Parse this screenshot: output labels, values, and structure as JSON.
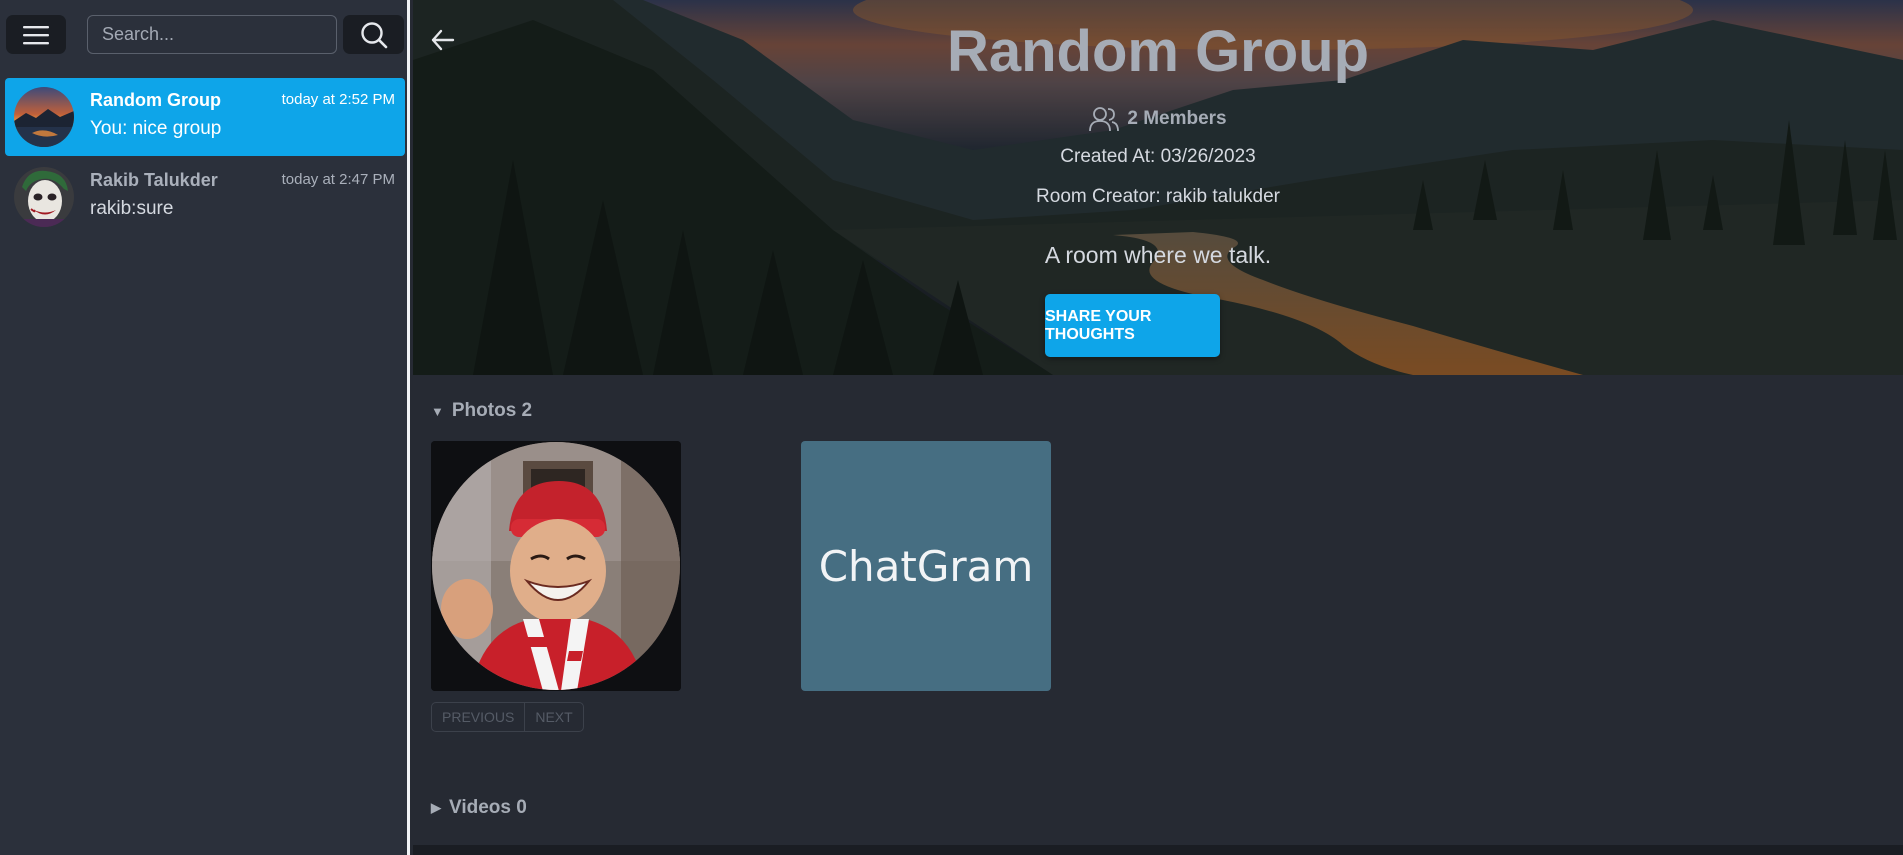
{
  "sidebar": {
    "search": {
      "placeholder": "Search..."
    },
    "chats": [
      {
        "name": "Random Group",
        "time": "today at 2:52 PM",
        "preview": "You: nice group",
        "active": true,
        "avatar": "landscape-avatar"
      },
      {
        "name": "Rakib Talukder",
        "time": "today at 2:47 PM",
        "preview": "rakib:sure",
        "active": false,
        "avatar": "joker-avatar"
      }
    ]
  },
  "room": {
    "title": "Random Group",
    "members": "2 Members",
    "created_at": "Created At: 03/26/2023",
    "creator": "Room Creator: rakib talukder",
    "description": "A room where we talk.",
    "share_label": "SHARE YOUR THOUGHTS"
  },
  "photos": {
    "label": "Photos 2",
    "items": [
      {
        "type": "image",
        "icon": "smiling-person-photo"
      },
      {
        "type": "text",
        "text": "ChatGram"
      }
    ],
    "prev_label": "PREVIOUS",
    "next_label": "NEXT"
  },
  "videos": {
    "label": "Videos 0"
  },
  "colors": {
    "accent": "#0ea5e9",
    "sidebar_bg": "#2b303b",
    "main_bg": "#262a33",
    "muted_text": "#a6acb6"
  }
}
